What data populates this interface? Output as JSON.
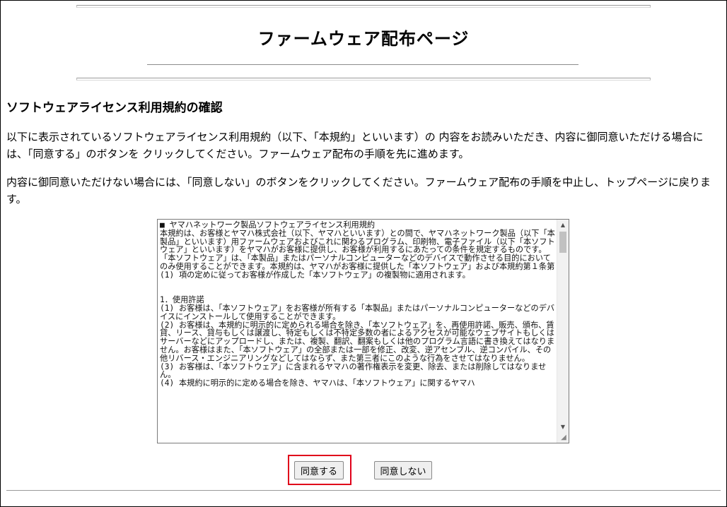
{
  "page": {
    "title": "ファームウェア配布ページ"
  },
  "section": {
    "heading": "ソフトウェアライセンス利用規約の確認",
    "paragraph1": "以下に表示されているソフトウェアライセンス利用規約（以下、「本規約」といいます）の 内容をお読みいただき、内容に御同意いただける場合には、「同意する」のボタンを クリックしてください。ファームウェア配布の手順を先に進めます。",
    "paragraph2": "内容に御同意いただけない場合には、「同意しない」のボタンをクリックしてください。ファームウェア配布の手順を中止し、トップページに戻ります。"
  },
  "license": {
    "text": "■ ヤマハネットワーク製品ソフトウェアライセンス利用規約\n本規約は、お客様とヤマハ株式会社（以下、ヤマハといいます）との間で、ヤマハネットワーク製品（以下「本製品」といいます）用ファームウェアおよびこれに関わるプログラム、印刷物、電子ファイル（以下「本ソフトウェア」といいます）をヤマハがお客様に提供し、お客様が利用するにあたっての条件を規定するものです。\n「本ソフトウェア」は、「本製品」またはパーソナルコンピューターなどのデバイスで動作させる目的においてのみ使用することができます。本規約は、ヤマハがお客様に提供した「本ソフトウェア」および本規約第１条第(1) 項の定めに従ってお客様が作成した「本ソフトウェア」の複製物に適用されます。\n\n\n1．使用許諾\n(1) お客様は、「本ソフトウェア」をお客様が所有する「本製品」またはパーソナルコンピューターなどのデバイスにインストールして使用することができます。\n(2) お客様は、本規約に明示的に定められる場合を除き、「本ソフトウェア」を、再使用許諾、販売、頒布、賃貸、リース、貸与もしくは譲渡し、特定もしくは不特定多数の者によるアクセスが可能なウェブサイトもしくはサーバーなどにアップロードし、または、複製、翻訳、翻案もしくは他のプログラム言語に書き換えてはなりません。お客様はまた、「本ソフトウェア」の全部または一部を修正、改変、逆アセンブル、逆コンパイル、その他リバース・エンジニアリングなどしてはならず、また第三者にこのような行為をさせてはなりません。\n(3) お客様は、「本ソフトウェア」に含まれるヤマハの著作権表示を変更、除去、または削除してはなりません。\n(4) 本規約に明示的に定める場合を除き、ヤマハは、「本ソフトウェア」に関するヤマハ"
  },
  "buttons": {
    "agree": "同意する",
    "disagree": "同意しない"
  },
  "icons": {
    "scroll_up": "triangle-up-icon",
    "scroll_down": "triangle-down-icon",
    "resize": "resize-grip-icon"
  },
  "colors": {
    "highlight": "#e0001a"
  }
}
